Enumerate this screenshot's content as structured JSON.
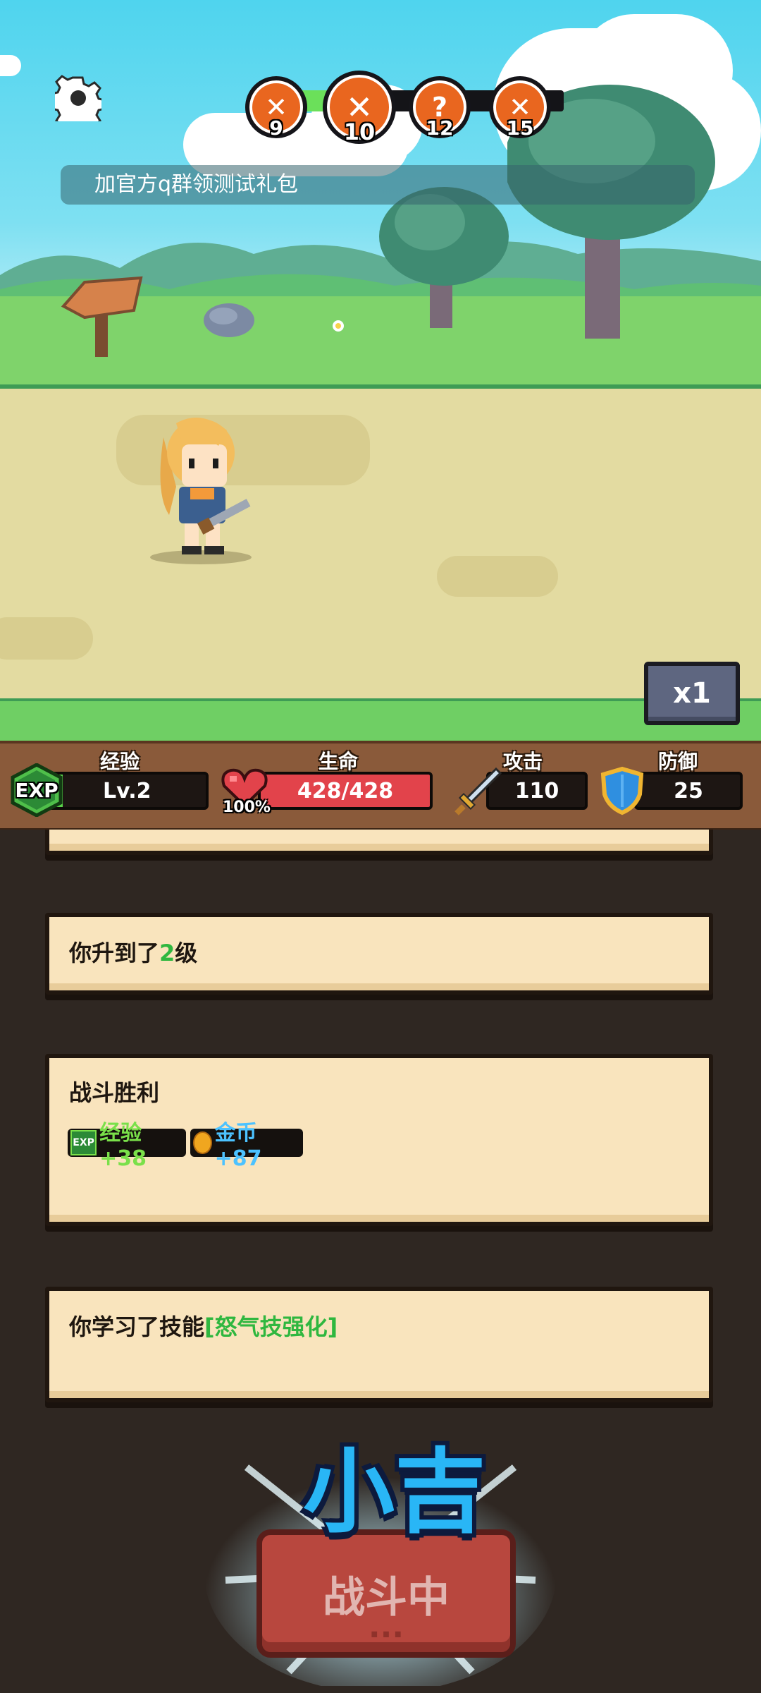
{
  "game": {
    "notice_text": "加官方q群领测试礼包",
    "speed_label": "x1",
    "stages": [
      {
        "number": "9",
        "icon": "crossed-swords-icon",
        "state": "done"
      },
      {
        "number": "10",
        "icon": "crossed-swords-icon",
        "state": "current"
      },
      {
        "number": "12",
        "icon": "question-icon",
        "state": "upcoming"
      },
      {
        "number": "15",
        "icon": "crossed-swords-icon",
        "state": "upcoming"
      }
    ],
    "stage_progress": 0.15
  },
  "stats": {
    "exp": {
      "label": "经验",
      "icon_text": "EXP",
      "level": "Lv.2",
      "fill": 0.1
    },
    "hp": {
      "label": "生命",
      "value": "428/428",
      "percent": "100%",
      "fill": 1.0
    },
    "attack": {
      "label": "攻击",
      "value": "110"
    },
    "defense": {
      "label": "防御",
      "value": "25"
    }
  },
  "log": {
    "levelup": {
      "prefix": "你升到了",
      "level": "2",
      "suffix": "级"
    },
    "victory": {
      "title": "战斗胜利",
      "exp_icon": "EXP",
      "exp_reward": "经验+38",
      "gold_reward": "金币+87"
    },
    "skill": {
      "prefix": "你学习了技能",
      "skill_name": "[怒气技强化]"
    }
  },
  "overlay": {
    "luck_text": "小吉"
  },
  "battle_button": {
    "label": "战斗中",
    "dots": "..."
  },
  "colors": {
    "sky": "#4fd4ee",
    "hp_red": "#e2434b",
    "exp_green": "#5ad34a",
    "reward_green": "#7ae04a",
    "reward_blue": "#4cc2ff",
    "card": "#f9e4bd",
    "button_red": "#b8473e",
    "luck_blue": "#29b6f6"
  }
}
